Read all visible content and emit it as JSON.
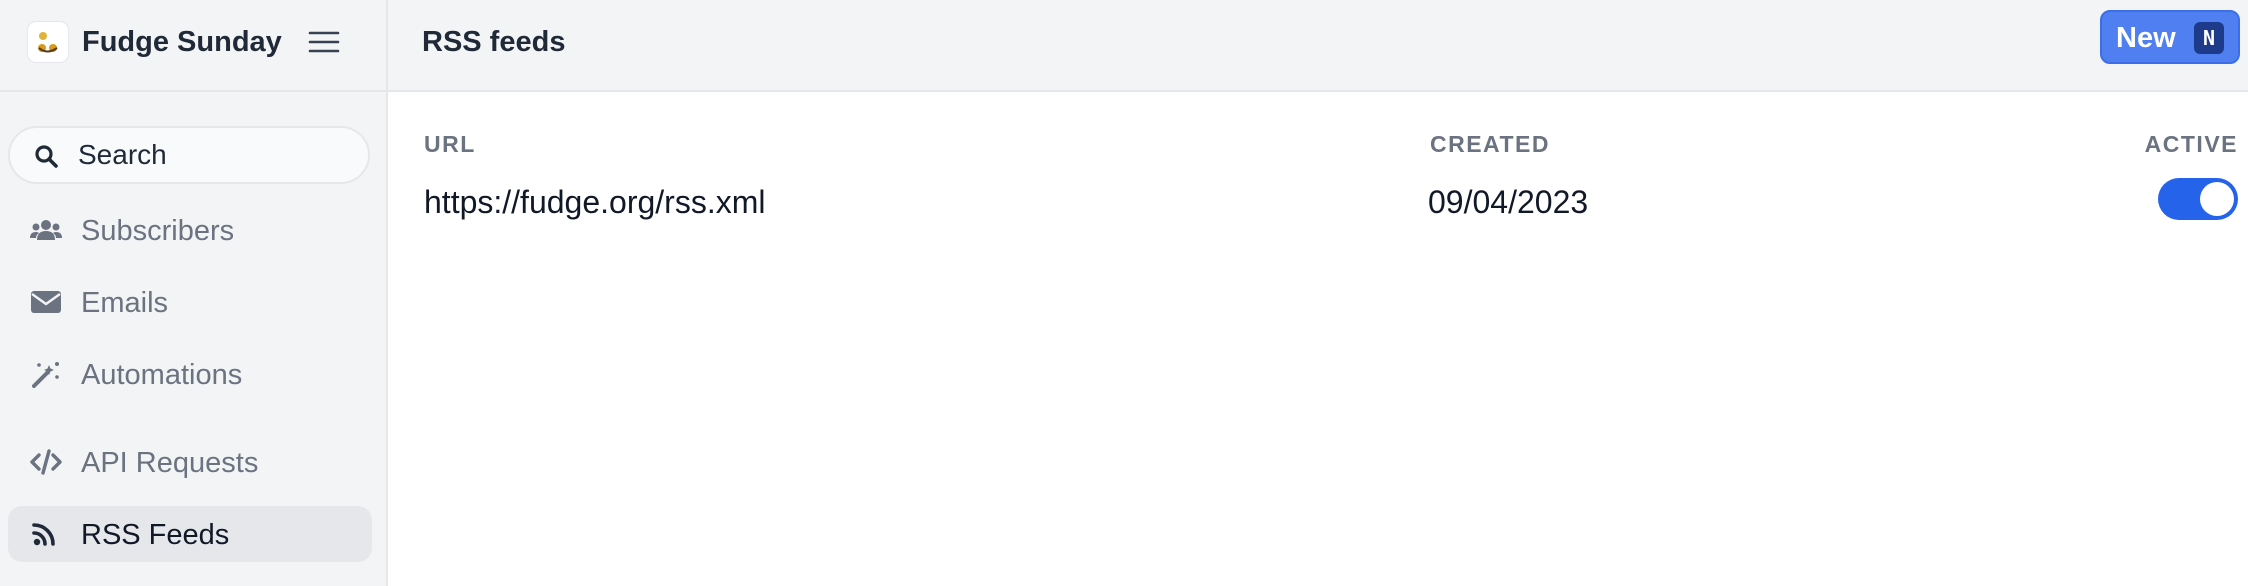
{
  "app": {
    "name": "Fudge Sunday"
  },
  "sidebar": {
    "search_placeholder": "Search",
    "items": [
      {
        "label": "Subscribers",
        "icon": "users-icon"
      },
      {
        "label": "Emails",
        "icon": "envelope-icon"
      },
      {
        "label": "Automations",
        "icon": "magic-wand-icon"
      },
      {
        "label": "API Requests",
        "icon": "code-icon"
      },
      {
        "label": "RSS Feeds",
        "icon": "rss-icon",
        "active": true
      }
    ]
  },
  "header": {
    "title": "RSS feeds",
    "new_label": "New",
    "new_shortcut": "N"
  },
  "table": {
    "columns": [
      "URL",
      "CREATED",
      "ACTIVE"
    ],
    "rows": [
      {
        "url": "https://fudge.org/rss.xml",
        "created": "09/04/2023",
        "active": true
      }
    ]
  },
  "colors": {
    "accent": "#2563eb",
    "button": "#4f7ff0",
    "sidebar_bg": "#f3f4f6"
  }
}
